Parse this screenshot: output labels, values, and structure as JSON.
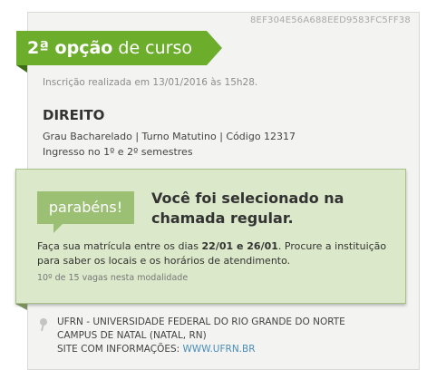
{
  "card": {
    "hash": "8EF304E56A688EED9583FC5FF38",
    "ribbon": {
      "ordinal": "2ª opção",
      "rest": " de curso"
    },
    "timestamp": "Inscrição realizada em 13/01/2016 às 15h28.",
    "course": {
      "title": "DIREITO",
      "meta": "Grau Bacharelado | Turno Matutino | Código 12317",
      "entry": "Ingresso no 1º e 2º semestres"
    },
    "result": {
      "badge": "parabéns!",
      "headline": "Você foi selecionado na chamada regular.",
      "text_before": "Faça sua matrícula entre os dias ",
      "dates": "22/01 e 26/01",
      "text_after": ". Procure a instituição para saber os locais e os horários de atendimento.",
      "vacancy": "10º de 15 vagas nesta modalidade"
    },
    "institution": {
      "name": "UFRN - UNIVERSIDADE FEDERAL DO RIO GRANDE DO NORTE",
      "campus": "CAMPUS DE NATAL (NATAL, RN)",
      "site_label": "SITE COM INFORMAÇÕES: ",
      "site_url": "WWW.UFRN.BR"
    }
  },
  "colors": {
    "ribbon": "#6cad2c",
    "result_bg": "#dbe8c9",
    "badge": "#9bbf73",
    "link": "#4a8db8"
  }
}
